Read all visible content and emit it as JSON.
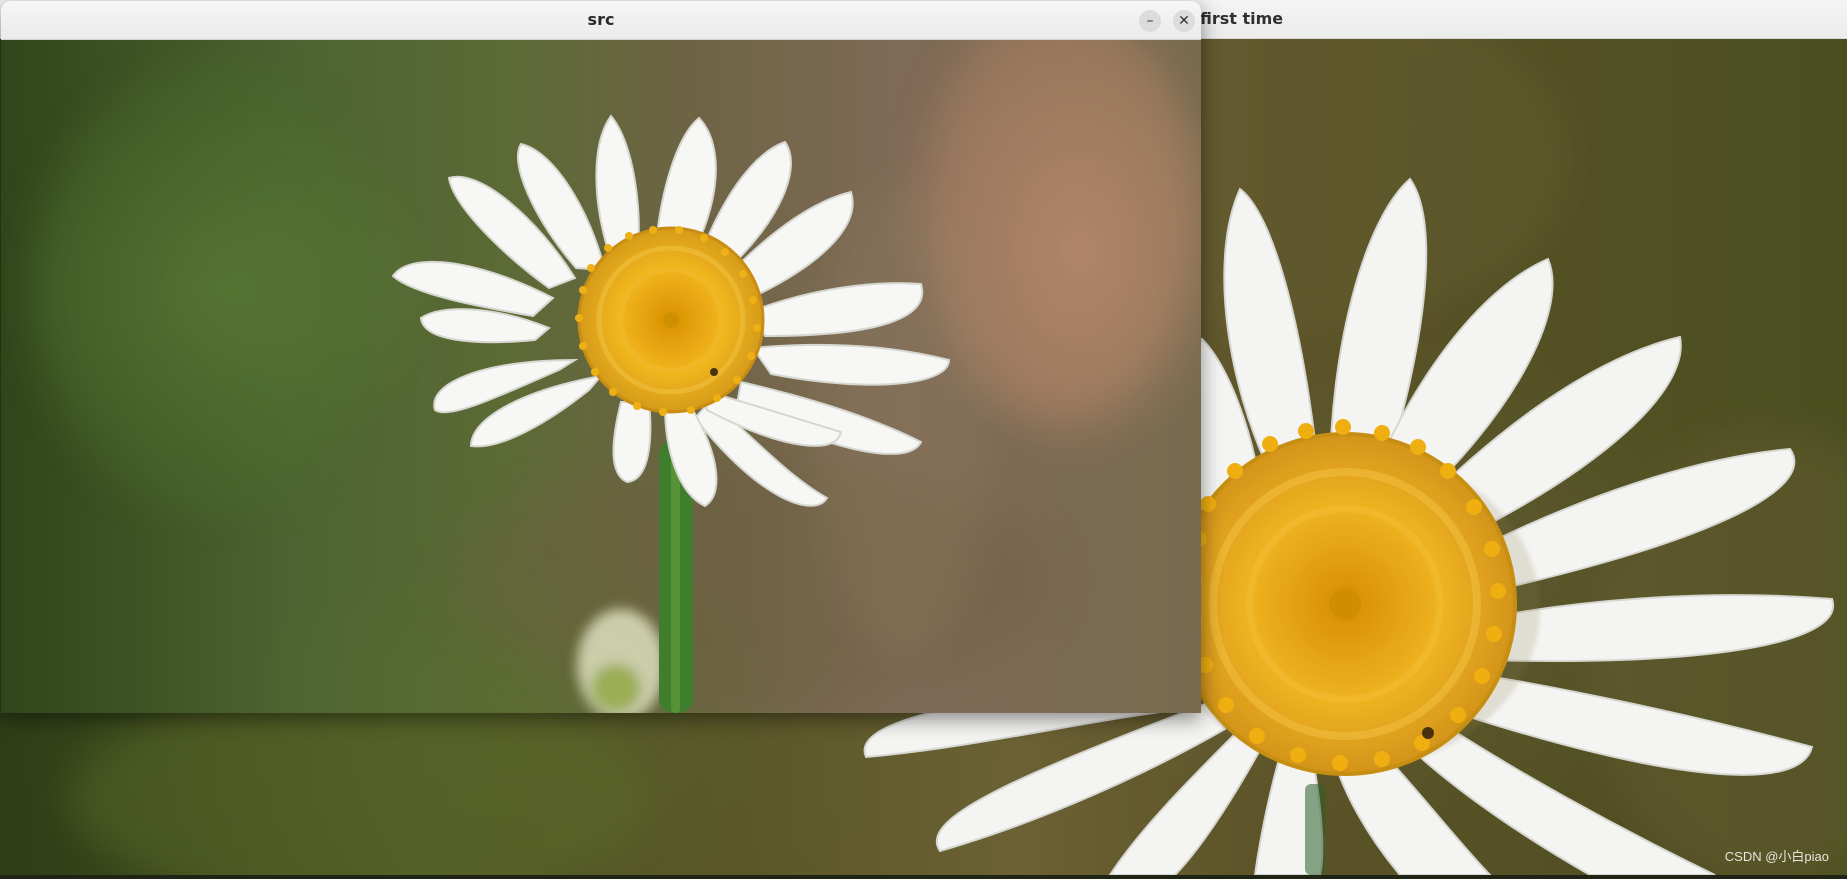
{
  "windows": {
    "back": {
      "title": "first time"
    },
    "front": {
      "title": "src",
      "controls": {
        "minimize_icon": "–",
        "close_icon": "✕"
      }
    }
  },
  "image": {
    "watermark": "CSDN @小白piao"
  }
}
